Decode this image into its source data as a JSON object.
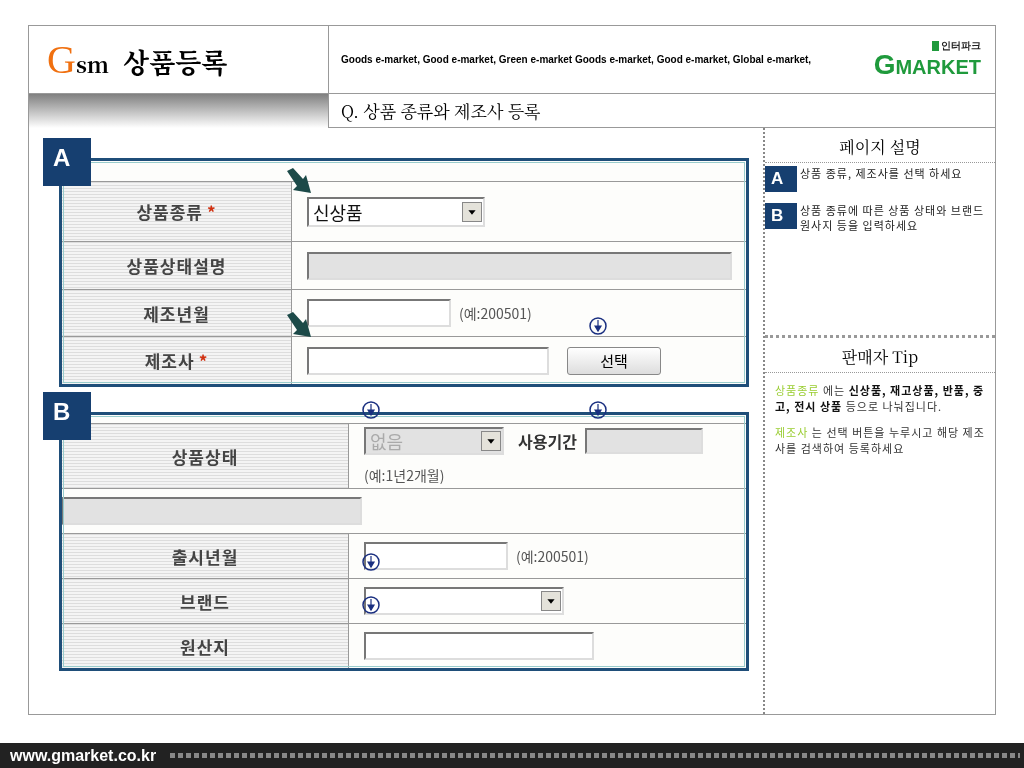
{
  "header": {
    "logo_letter": "G",
    "logo_sm": "sm",
    "title": "상품등록",
    "tagline": "Goods e-market, Good e-market, Green e-market Goods e-market, Good e-market, Global e-market,",
    "brand": {
      "letter": "G",
      "word": "MARKET",
      "badge": "인터파크"
    }
  },
  "question": "Q. 상품 종류와 제조사 등록",
  "sections": [
    {
      "badge": "A",
      "rows": [
        {
          "kind": "select",
          "label": "상품종류",
          "mark": "*",
          "value": "신상품"
        },
        {
          "kind": "readonly",
          "label": "상품상태설명"
        },
        {
          "kind": "input",
          "label": "제조년월",
          "hint": "(예:200501)"
        },
        {
          "kind": "search",
          "label": "제조사",
          "mark": "*",
          "button": "선택"
        }
      ]
    },
    {
      "badge": "B",
      "rows": [
        {
          "kind": "condition",
          "label": "상품상태",
          "value": "없음",
          "disabled": true,
          "period_label": "사용기간",
          "hint": "(예:1년2개월)"
        },
        {
          "kind": "blank"
        },
        {
          "kind": "input",
          "label": "출시년월",
          "hint": "(예:200501)"
        },
        {
          "kind": "select",
          "label": "브랜드"
        },
        {
          "kind": "input",
          "label": "원산지"
        }
      ]
    }
  ],
  "side": {
    "title": "페이지 설명",
    "items": [
      {
        "badge": "A",
        "text": "상품 종류, 제조사를 선택 하세요"
      },
      {
        "badge": "B",
        "text": "상품 종류에 따른 상품 상태와 브랜드 원사지 등을 입력하세요"
      }
    ],
    "tip_title": "판매자 Tip",
    "tips": [
      {
        "keyword": "상품종류",
        "text": " 에는 **신상품, 재고상품, 반품, 중고, 전시 상품** 등으로 나눠집니다."
      },
      {
        "keyword": "제조사",
        "text": " 는 선택 버튼을 누루시고 해당 제조사를 검색하여 등록하세요"
      }
    ]
  },
  "footer": {
    "url": "www.gmarket.co.kr"
  }
}
